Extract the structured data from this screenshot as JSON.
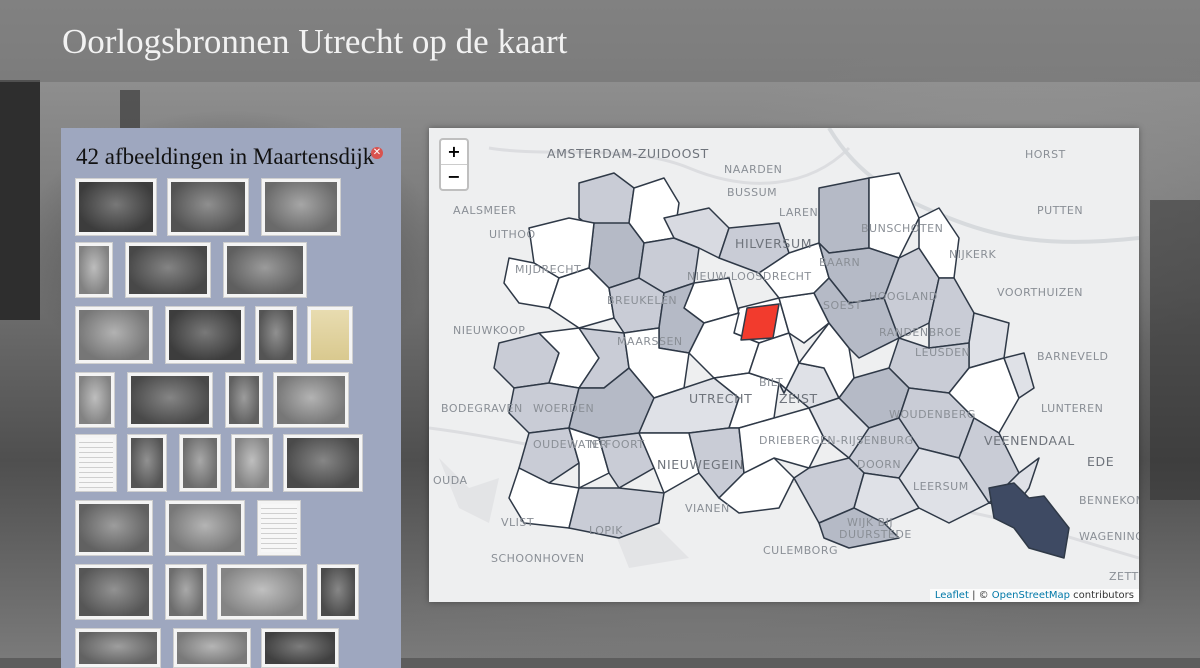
{
  "header": {
    "title": "Oorlogsbronnen Utrecht op de kaart"
  },
  "panel": {
    "title": "42 afbeeldingen in Maartensdijk",
    "close_icon": "close-icon",
    "thumbnail_count_visible": 28
  },
  "map": {
    "zoom_in": "+",
    "zoom_out": "−",
    "attribution": {
      "leaflet": "Leaflet",
      "separator": " | © ",
      "osm": "OpenStreetMap",
      "suffix": " contributors"
    },
    "place_labels": {
      "amsterdam_zuidoost": "AMSTERDAM-ZUIDOOST",
      "naarden": "NAARDEN",
      "bussum": "BUSSUM",
      "laren": "LAREN",
      "horst": "HORST",
      "aalsmeer": "AALSMEER",
      "uithoorn": "UITHOO",
      "putten": "PUTTEN",
      "hilversum": "HILVERSUM",
      "bunschoten": "BUNSCHOTEN",
      "nijkerk": "NIJKERK",
      "mijdrecht": "MIJDRECHT",
      "baarn": "BAARN",
      "nieuw_loosdrecht": "NIEUW-LOOSDRECHT",
      "soest": "SOEST",
      "hoogland": "HOOGLAND",
      "voorthuizen": "VOORTHUIZEN",
      "breukelen": "BREUKELEN",
      "nieuwkoop": "NIEUWKOOP",
      "randenbroek": "RANDENBROE",
      "barneveld": "BARNEVELD",
      "maarssen": "MAARSSEN",
      "leusden": "LEUSDEN",
      "bilt": "BILT",
      "utrecht": "UTRECHT",
      "zeist": "ZEIST",
      "bodegraven": "BODEGRAVEN",
      "woerden": "WOERDEN",
      "woudenberg": "WOUDENBERG",
      "lunteren": "LUNTEREN",
      "driebergen": "DRIEBERGEN-RIJSENBURG",
      "oudewater": "OUDEWATER",
      "ijsselstein": "NTFOORT",
      "nieuwegein": "NIEUWEGEIN",
      "doorn": "DOORN",
      "veenendaal": "VEENENDAAL",
      "ede": "EDE",
      "gouda": "OUDA",
      "leersum": "LEERSUM",
      "bennekom": "BENNEKOM",
      "vianen": "VIANEN",
      "wijk": "WIJK BIJ",
      "duurstede": "DUURSTEDE",
      "wageningen": "WAGENINGEN",
      "vlist": "VLIST",
      "lopik": "LOPIK",
      "schoonhoven": "SCHOONHOVEN",
      "culemborg": "CULEMBORG",
      "zett": "ZETT"
    }
  },
  "colors": {
    "selected": "#f23b2d",
    "top_region": "#3e4a63",
    "panel": "#9ea7bf"
  }
}
